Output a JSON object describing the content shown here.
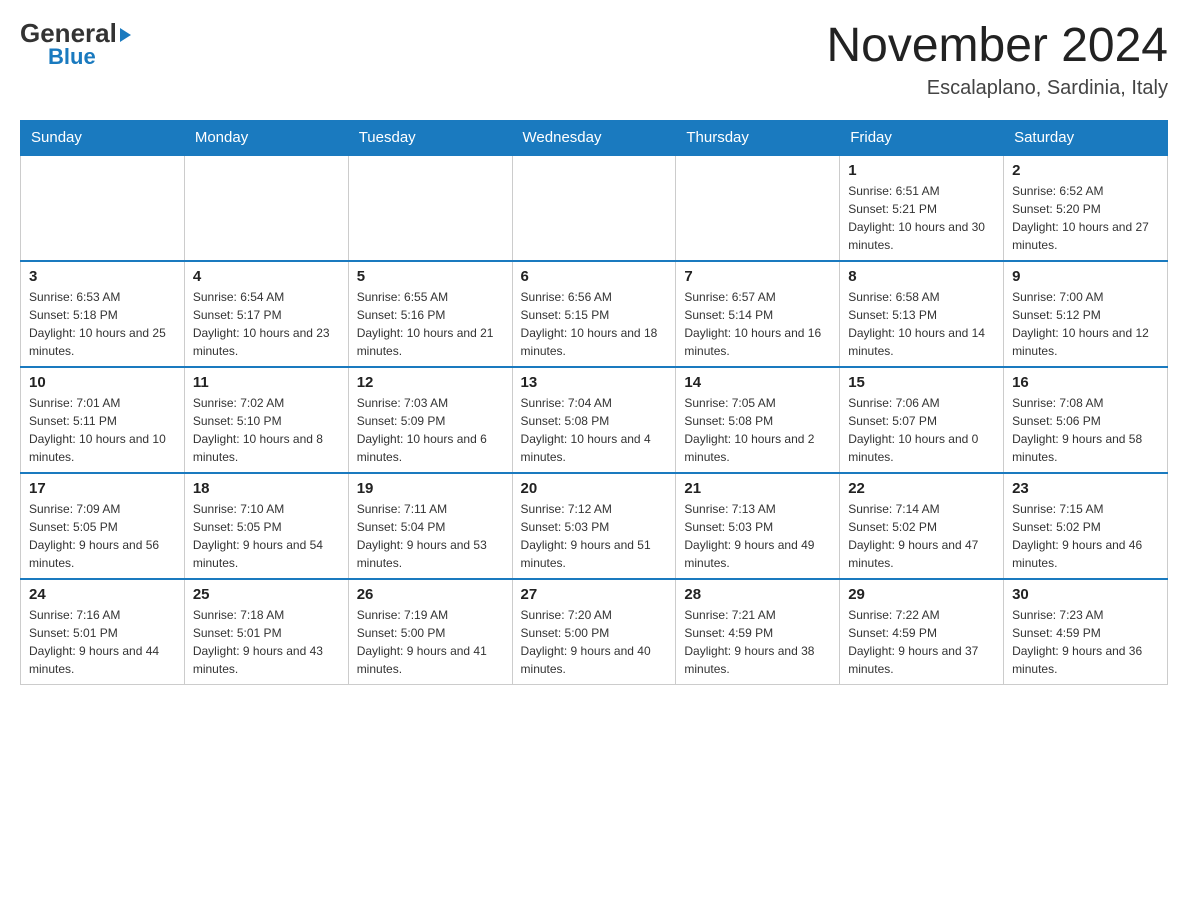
{
  "header": {
    "logo_general": "General",
    "logo_triangle": "▶",
    "logo_blue": "Blue",
    "month_year": "November 2024",
    "location": "Escalaplano, Sardinia, Italy"
  },
  "weekdays": [
    "Sunday",
    "Monday",
    "Tuesday",
    "Wednesday",
    "Thursday",
    "Friday",
    "Saturday"
  ],
  "weeks": [
    [
      {
        "day": "",
        "info": ""
      },
      {
        "day": "",
        "info": ""
      },
      {
        "day": "",
        "info": ""
      },
      {
        "day": "",
        "info": ""
      },
      {
        "day": "",
        "info": ""
      },
      {
        "day": "1",
        "info": "Sunrise: 6:51 AM\nSunset: 5:21 PM\nDaylight: 10 hours and 30 minutes."
      },
      {
        "day": "2",
        "info": "Sunrise: 6:52 AM\nSunset: 5:20 PM\nDaylight: 10 hours and 27 minutes."
      }
    ],
    [
      {
        "day": "3",
        "info": "Sunrise: 6:53 AM\nSunset: 5:18 PM\nDaylight: 10 hours and 25 minutes."
      },
      {
        "day": "4",
        "info": "Sunrise: 6:54 AM\nSunset: 5:17 PM\nDaylight: 10 hours and 23 minutes."
      },
      {
        "day": "5",
        "info": "Sunrise: 6:55 AM\nSunset: 5:16 PM\nDaylight: 10 hours and 21 minutes."
      },
      {
        "day": "6",
        "info": "Sunrise: 6:56 AM\nSunset: 5:15 PM\nDaylight: 10 hours and 18 minutes."
      },
      {
        "day": "7",
        "info": "Sunrise: 6:57 AM\nSunset: 5:14 PM\nDaylight: 10 hours and 16 minutes."
      },
      {
        "day": "8",
        "info": "Sunrise: 6:58 AM\nSunset: 5:13 PM\nDaylight: 10 hours and 14 minutes."
      },
      {
        "day": "9",
        "info": "Sunrise: 7:00 AM\nSunset: 5:12 PM\nDaylight: 10 hours and 12 minutes."
      }
    ],
    [
      {
        "day": "10",
        "info": "Sunrise: 7:01 AM\nSunset: 5:11 PM\nDaylight: 10 hours and 10 minutes."
      },
      {
        "day": "11",
        "info": "Sunrise: 7:02 AM\nSunset: 5:10 PM\nDaylight: 10 hours and 8 minutes."
      },
      {
        "day": "12",
        "info": "Sunrise: 7:03 AM\nSunset: 5:09 PM\nDaylight: 10 hours and 6 minutes."
      },
      {
        "day": "13",
        "info": "Sunrise: 7:04 AM\nSunset: 5:08 PM\nDaylight: 10 hours and 4 minutes."
      },
      {
        "day": "14",
        "info": "Sunrise: 7:05 AM\nSunset: 5:08 PM\nDaylight: 10 hours and 2 minutes."
      },
      {
        "day": "15",
        "info": "Sunrise: 7:06 AM\nSunset: 5:07 PM\nDaylight: 10 hours and 0 minutes."
      },
      {
        "day": "16",
        "info": "Sunrise: 7:08 AM\nSunset: 5:06 PM\nDaylight: 9 hours and 58 minutes."
      }
    ],
    [
      {
        "day": "17",
        "info": "Sunrise: 7:09 AM\nSunset: 5:05 PM\nDaylight: 9 hours and 56 minutes."
      },
      {
        "day": "18",
        "info": "Sunrise: 7:10 AM\nSunset: 5:05 PM\nDaylight: 9 hours and 54 minutes."
      },
      {
        "day": "19",
        "info": "Sunrise: 7:11 AM\nSunset: 5:04 PM\nDaylight: 9 hours and 53 minutes."
      },
      {
        "day": "20",
        "info": "Sunrise: 7:12 AM\nSunset: 5:03 PM\nDaylight: 9 hours and 51 minutes."
      },
      {
        "day": "21",
        "info": "Sunrise: 7:13 AM\nSunset: 5:03 PM\nDaylight: 9 hours and 49 minutes."
      },
      {
        "day": "22",
        "info": "Sunrise: 7:14 AM\nSunset: 5:02 PM\nDaylight: 9 hours and 47 minutes."
      },
      {
        "day": "23",
        "info": "Sunrise: 7:15 AM\nSunset: 5:02 PM\nDaylight: 9 hours and 46 minutes."
      }
    ],
    [
      {
        "day": "24",
        "info": "Sunrise: 7:16 AM\nSunset: 5:01 PM\nDaylight: 9 hours and 44 minutes."
      },
      {
        "day": "25",
        "info": "Sunrise: 7:18 AM\nSunset: 5:01 PM\nDaylight: 9 hours and 43 minutes."
      },
      {
        "day": "26",
        "info": "Sunrise: 7:19 AM\nSunset: 5:00 PM\nDaylight: 9 hours and 41 minutes."
      },
      {
        "day": "27",
        "info": "Sunrise: 7:20 AM\nSunset: 5:00 PM\nDaylight: 9 hours and 40 minutes."
      },
      {
        "day": "28",
        "info": "Sunrise: 7:21 AM\nSunset: 4:59 PM\nDaylight: 9 hours and 38 minutes."
      },
      {
        "day": "29",
        "info": "Sunrise: 7:22 AM\nSunset: 4:59 PM\nDaylight: 9 hours and 37 minutes."
      },
      {
        "day": "30",
        "info": "Sunrise: 7:23 AM\nSunset: 4:59 PM\nDaylight: 9 hours and 36 minutes."
      }
    ]
  ]
}
